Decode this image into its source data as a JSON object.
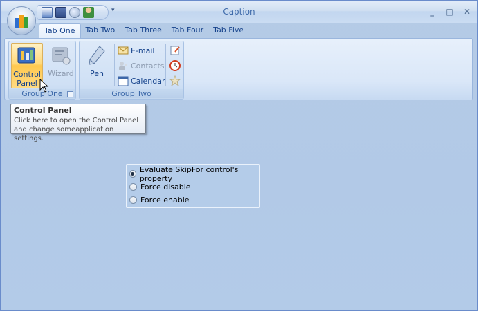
{
  "window": {
    "caption": "Caption",
    "controls": {
      "minimize": "_",
      "maximize": "□",
      "close": "✕"
    }
  },
  "quick_access": {
    "items": [
      "app-icon",
      "save-icon",
      "search-icon",
      "user-icon"
    ],
    "more": "▾"
  },
  "tabs": [
    {
      "label": "Tab One",
      "active": true
    },
    {
      "label": "Tab Two",
      "active": false
    },
    {
      "label": "Tab Three",
      "active": false
    },
    {
      "label": "Tab Four",
      "active": false
    },
    {
      "label": "Tab Five",
      "active": false
    }
  ],
  "ribbon": {
    "group_one": {
      "label": "Group One",
      "control_panel": "Control\nPanel",
      "wizard": "Wizard"
    },
    "group_two": {
      "label": "Group Two",
      "pen": "Pen",
      "email": "E-mail",
      "contacts": "Contacts",
      "calendar": "Calendar"
    }
  },
  "tooltip": {
    "title": "Control Panel",
    "line1": "Click here to open the Control Panel",
    "line2": "and change someapplication settings."
  },
  "options": {
    "items": [
      {
        "label": "Evaluate SkipFor control's property",
        "checked": true
      },
      {
        "label": "Force disable",
        "checked": false
      },
      {
        "label": "Force enable",
        "checked": false
      }
    ]
  }
}
